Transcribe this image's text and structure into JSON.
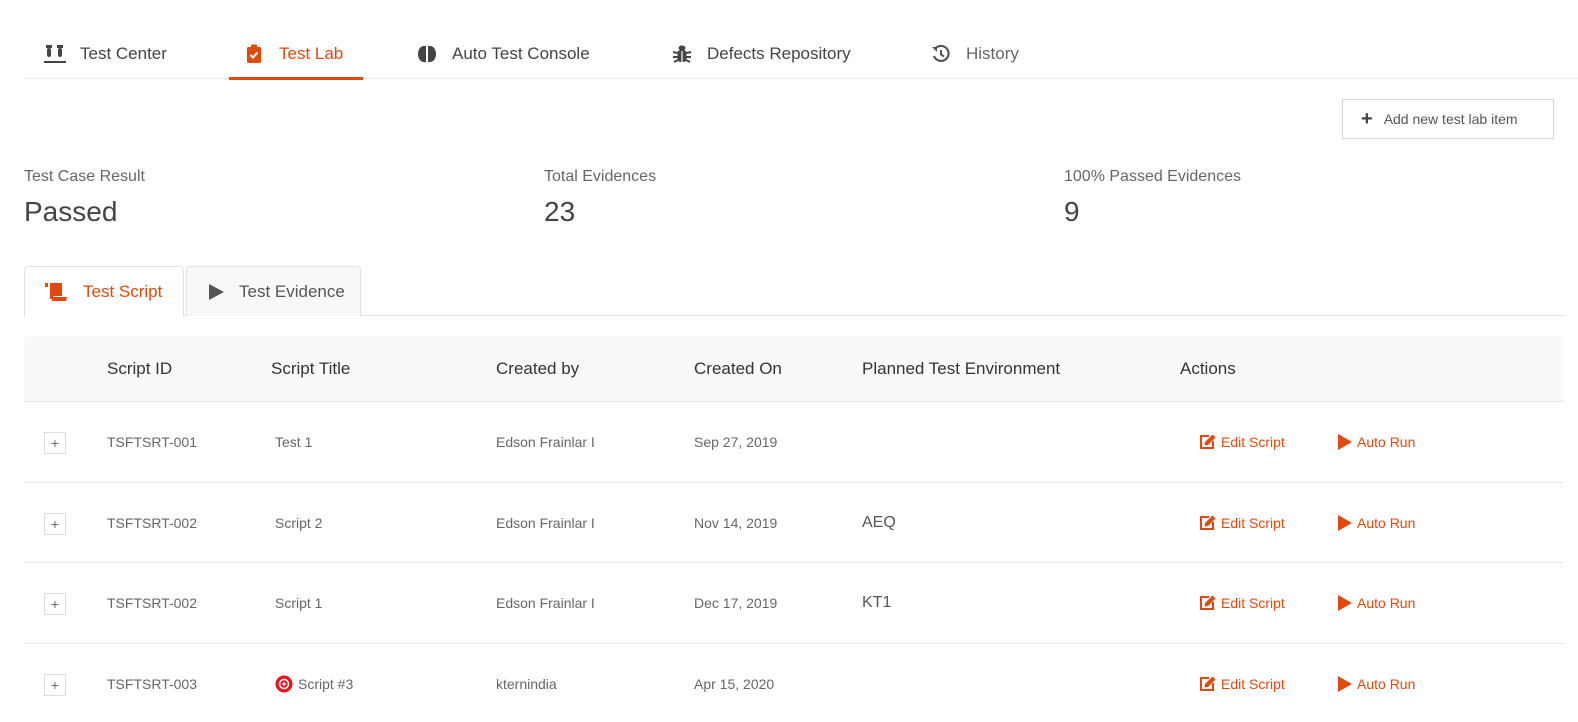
{
  "nav": {
    "tabs": [
      {
        "label": "Test Center",
        "icon": "test-tubes-icon"
      },
      {
        "label": "Test Lab",
        "icon": "clipboard-check-icon",
        "active": true
      },
      {
        "label": "Auto Test Console",
        "icon": "brain-icon"
      },
      {
        "label": "Defects Repository",
        "icon": "bug-icon"
      },
      {
        "label": "History",
        "icon": "history-icon"
      }
    ]
  },
  "toolbar": {
    "add_label": "Add new test lab item",
    "add_icon": "plus-icon"
  },
  "stats": [
    {
      "label": "Test Case Result",
      "value": "Passed"
    },
    {
      "label": "Total Evidences",
      "value": "23"
    },
    {
      "label": "100% Passed Evidences",
      "value": "9"
    }
  ],
  "subtabs": [
    {
      "label": "Test Script",
      "icon": "scroll-icon",
      "active": true
    },
    {
      "label": "Test Evidence",
      "icon": "play-icon"
    }
  ],
  "table": {
    "columns": [
      "Script ID",
      "Script Title",
      "Created by",
      "Created On",
      "Planned Test Environment",
      "Actions"
    ],
    "expand_label": "+",
    "edit_label": "Edit Script",
    "run_label": "Auto Run",
    "rows": [
      {
        "id": "TSFTSRT-001",
        "title": "Test 1",
        "created_by": "Edson Frainlar I",
        "created_on": "Sep 27, 2019",
        "env": "",
        "flag": false
      },
      {
        "id": "TSFTSRT-002",
        "title": "Script 2",
        "created_by": "Edson Frainlar I",
        "created_on": "Nov 14, 2019",
        "env": "AEQ",
        "flag": false
      },
      {
        "id": "TSFTSRT-002",
        "title": "Script 1",
        "created_by": "Edson Frainlar I",
        "created_on": "Dec 17, 2019",
        "env": "KT1",
        "flag": false
      },
      {
        "id": "TSFTSRT-003",
        "title": "Script #3",
        "created_by": "kternindia",
        "created_on": "Apr 15, 2020",
        "env": "",
        "flag": true
      }
    ]
  },
  "colors": {
    "accent": "#e04a0f",
    "flag": "#e8141b"
  }
}
